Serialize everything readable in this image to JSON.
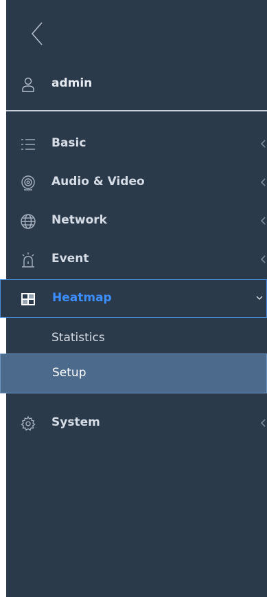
{
  "user": {
    "name": "admin"
  },
  "menu": {
    "items": [
      {
        "label": "Basic",
        "icon": "list-icon",
        "expanded": false
      },
      {
        "label": "Audio & Video",
        "icon": "camera-icon",
        "expanded": false
      },
      {
        "label": "Network",
        "icon": "globe-icon",
        "expanded": false
      },
      {
        "label": "Event",
        "icon": "alarm-icon",
        "expanded": false
      },
      {
        "label": "Heatmap",
        "icon": "heatmap-icon",
        "expanded": true,
        "active": true
      },
      {
        "label": "System",
        "icon": "gear-icon",
        "expanded": false
      }
    ],
    "heatmap_sub": [
      {
        "label": "Statistics",
        "selected": false
      },
      {
        "label": "Setup",
        "selected": true
      }
    ]
  },
  "colors": {
    "panel_bg": "#2b3a4b",
    "active_text": "#3d8eff",
    "active_border": "#4a8ee0",
    "selected_bg": "#4b6a8c",
    "text": "#d6dde6"
  }
}
